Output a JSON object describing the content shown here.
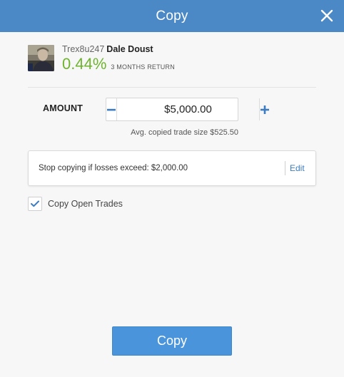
{
  "dialog": {
    "title": "Copy",
    "close_icon": "close-icon"
  },
  "trader": {
    "username": "Trex8u247",
    "full_name": "Dale Doust",
    "return_value": "0.44%",
    "return_label": "3 MONTHS RETURN",
    "return_color": "#6fb32f"
  },
  "amount": {
    "label": "AMOUNT",
    "value": "$5,000.00",
    "minus_icon": "minus-icon",
    "plus_icon": "plus-icon",
    "avg_trade_text": "Avg. copied trade size $525.50"
  },
  "stop_loss": {
    "text": "Stop copying if losses exceed: $2,000.00",
    "edit_label": "Edit"
  },
  "copy_open_trades": {
    "label": "Copy Open Trades",
    "checked": true
  },
  "actions": {
    "copy_label": "Copy"
  },
  "colors": {
    "header": "#4b88c6",
    "accent": "#3d7cc0",
    "button": "#4a94dc"
  }
}
